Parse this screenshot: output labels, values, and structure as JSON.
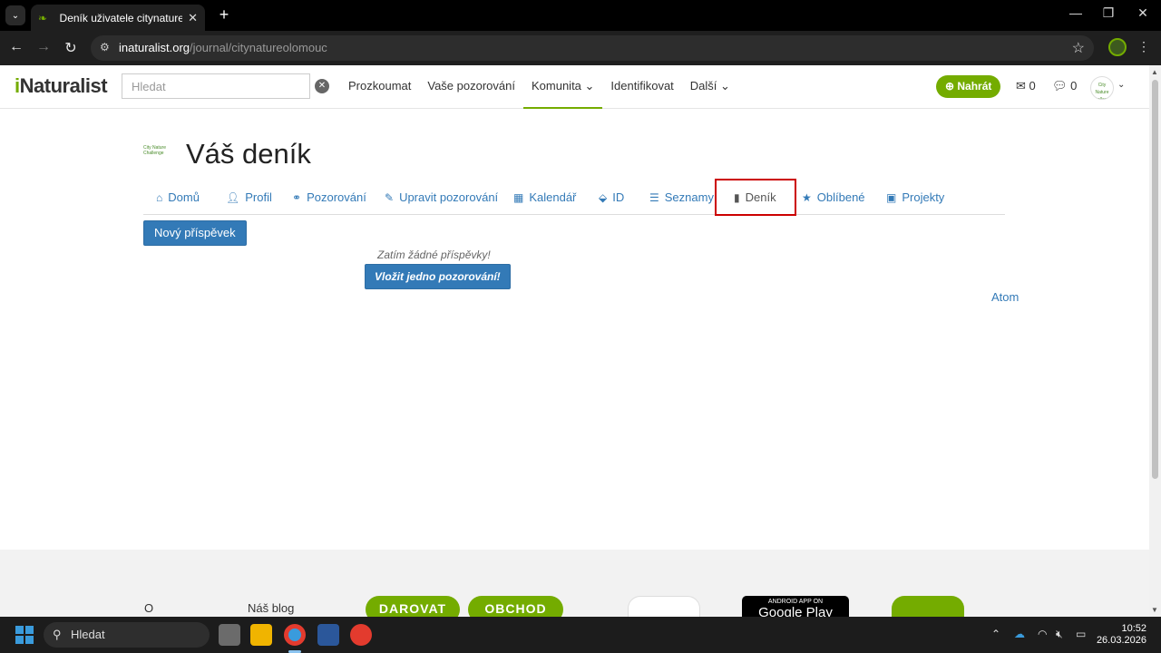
{
  "browser": {
    "tab_title": "Deník uživatele citynatureolomouc",
    "url_host": "inaturalist.org",
    "url_path": "/journal/citynatureolomouc"
  },
  "header": {
    "logo": "Naturalist",
    "logo_i": "i",
    "search_placeholder": "Hledat",
    "nav": [
      {
        "label": "Prozkoumat"
      },
      {
        "label": "Vaše pozorování"
      },
      {
        "label": "Komunita ⌄"
      },
      {
        "label": "Identifikovat"
      },
      {
        "label": "Další ⌄"
      }
    ],
    "upload_label": "Nahrát",
    "messages_count": "0",
    "notifications_count": "0",
    "avatar_text": "City Nature Challenge"
  },
  "page": {
    "title": "Váš deník",
    "title_logo_text": "City Nature Challenge",
    "subnav": [
      {
        "label": "Domů",
        "icon": "home-icon"
      },
      {
        "label": "Profil",
        "icon": "user-icon"
      },
      {
        "label": "Pozorování",
        "icon": "binoculars-icon"
      },
      {
        "label": "Upravit pozorování",
        "icon": "pencil-icon"
      },
      {
        "label": "Kalendář",
        "icon": "calendar-icon"
      },
      {
        "label": "ID",
        "icon": "tag-icon"
      },
      {
        "label": "Seznamy",
        "icon": "list-icon"
      },
      {
        "label": "Deník",
        "icon": "book-icon"
      },
      {
        "label": "Oblíbené",
        "icon": "star-icon"
      },
      {
        "label": "Projekty",
        "icon": "briefcase-icon"
      }
    ],
    "active_subnav": "Deník",
    "new_post_label": "Nový příspěvek",
    "empty_message": "Zatím žádné příspěvky!",
    "add_observation_label": "Vložit jedno pozorování!",
    "atom_label": "Atom"
  },
  "footer": {
    "links": [
      "O",
      "Náš blog"
    ],
    "donate_label": "DAROVAT",
    "shop_label": "OBCHOD",
    "android_badge_top": "ANDROID APP ON",
    "android_badge_main": "Google Play"
  },
  "taskbar": {
    "search_label": "Hledat",
    "time": "10:52",
    "date": "26.03.2026"
  },
  "colors": {
    "brand_green": "#74ac00",
    "link_blue": "#337ab7",
    "highlight_red": "#cc0000"
  }
}
